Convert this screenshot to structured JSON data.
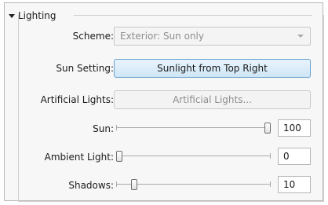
{
  "section": {
    "title": "Lighting",
    "expanded": true
  },
  "scheme": {
    "label": "Scheme:",
    "value": "Exterior: Sun only",
    "enabled": false
  },
  "sun_setting": {
    "label": "Sun Setting:",
    "button_label": "Sunlight from Top Right"
  },
  "artificial_lights": {
    "label": "Artificial Lights:",
    "button_label": "Artificial Lights...",
    "enabled": false
  },
  "sun": {
    "label": "Sun:",
    "value": "100",
    "min": 0,
    "max": 100
  },
  "ambient_light": {
    "label": "Ambient Light:",
    "value": "0",
    "min": 0,
    "max": 100
  },
  "shadows": {
    "label": "Shadows:",
    "value": "10",
    "min": 0,
    "max": 100
  },
  "colors": {
    "accent_button_border": "#6aa1cf",
    "accent_button_fill": "#cfe6f6",
    "disabled_text": "#8e8e8e"
  },
  "icons": {
    "collapse": "chevron-down-icon",
    "dropdown": "chevron-down-icon"
  }
}
